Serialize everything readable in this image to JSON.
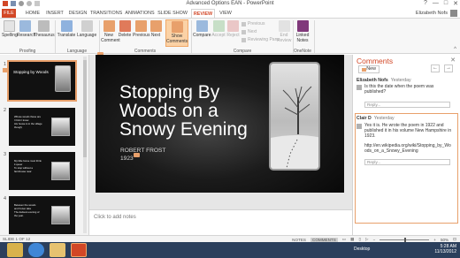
{
  "window": {
    "title": "Advanced Options EAN - PowerPoint",
    "controls": [
      "?",
      "—",
      "□",
      "✕"
    ]
  },
  "tabs": [
    "FILE",
    "HOME",
    "INSERT",
    "DESIGN",
    "TRANSITIONS",
    "ANIMATIONS",
    "SLIDE SHOW",
    "REVIEW",
    "VIEW"
  ],
  "active_tab": "REVIEW",
  "user": {
    "name": "Elizabeth Nofs"
  },
  "ribbon": {
    "proofing": {
      "label": "Proofing",
      "spelling": "Spelling",
      "research": "Research",
      "thesaurus": "Thesaurus"
    },
    "language": {
      "label": "Language",
      "translate": "Translate",
      "language": "Language"
    },
    "comments": {
      "label": "Comments",
      "new_comment": "New Comment",
      "delete": "Delete",
      "previous": "Previous",
      "next": "Next",
      "show_comments": "Show Comments"
    },
    "compare": {
      "label": "Compare",
      "compare": "Compare",
      "accept": "Accept",
      "reject": "Reject",
      "previous": "Previous",
      "next": "Next",
      "reviewing_pane": "Reviewing Pane",
      "end_review": "End Review"
    },
    "onenote": {
      "label": "OneNote",
      "linked_notes": "Linked Notes"
    }
  },
  "thumbnails": [
    {
      "number": "1",
      "title": "Stopping by Woods"
    },
    {
      "number": "2",
      "body": "Whose woods these are\nI think I know.\nHis house is in the village\nthough;"
    },
    {
      "number": "3",
      "body": "My little horse must think\nit queer\nTo stop without a\nfarmhouse near"
    },
    {
      "number": "4",
      "body": "Between the woods\nand frozen lake\nThe darkest evening of\nthe year."
    }
  ],
  "slide": {
    "title": "Stopping By Woods on a Snowy Evening",
    "author": "ROBERT FROST",
    "year": "1923"
  },
  "notes": {
    "placeholder": "Click to add notes"
  },
  "comments_pane": {
    "title": "Comments",
    "new_label": "New",
    "threads": [
      {
        "author": "Elizabeth Nofs",
        "time": "Yesterday",
        "text": "Is this the date when the poem was published?",
        "reply_placeholder": "Reply..."
      },
      {
        "author": "Clair D",
        "time": "Yesterday",
        "text": "Yes it is. He wrote the poem in 1922 and published it in his volume New Hampshire in 1923.",
        "link": "http://en.wikipedia.org/wiki/Stopping_by_Woods_on_a_Snowy_Evening",
        "reply_placeholder": "Reply..."
      }
    ]
  },
  "statusbar": {
    "slide_info": "SLIDE 1 OF 12",
    "notes": "NOTES",
    "comments": "COMMENTS",
    "zoom_percent": 50
  },
  "taskbar": {
    "desktop_label": "Desktop",
    "time": "5:28 AM",
    "date": "11/13/2012"
  },
  "colors": {
    "accent": "#d24726",
    "highlight": "#e8a06b",
    "taskbar": "#2b3f5c"
  }
}
